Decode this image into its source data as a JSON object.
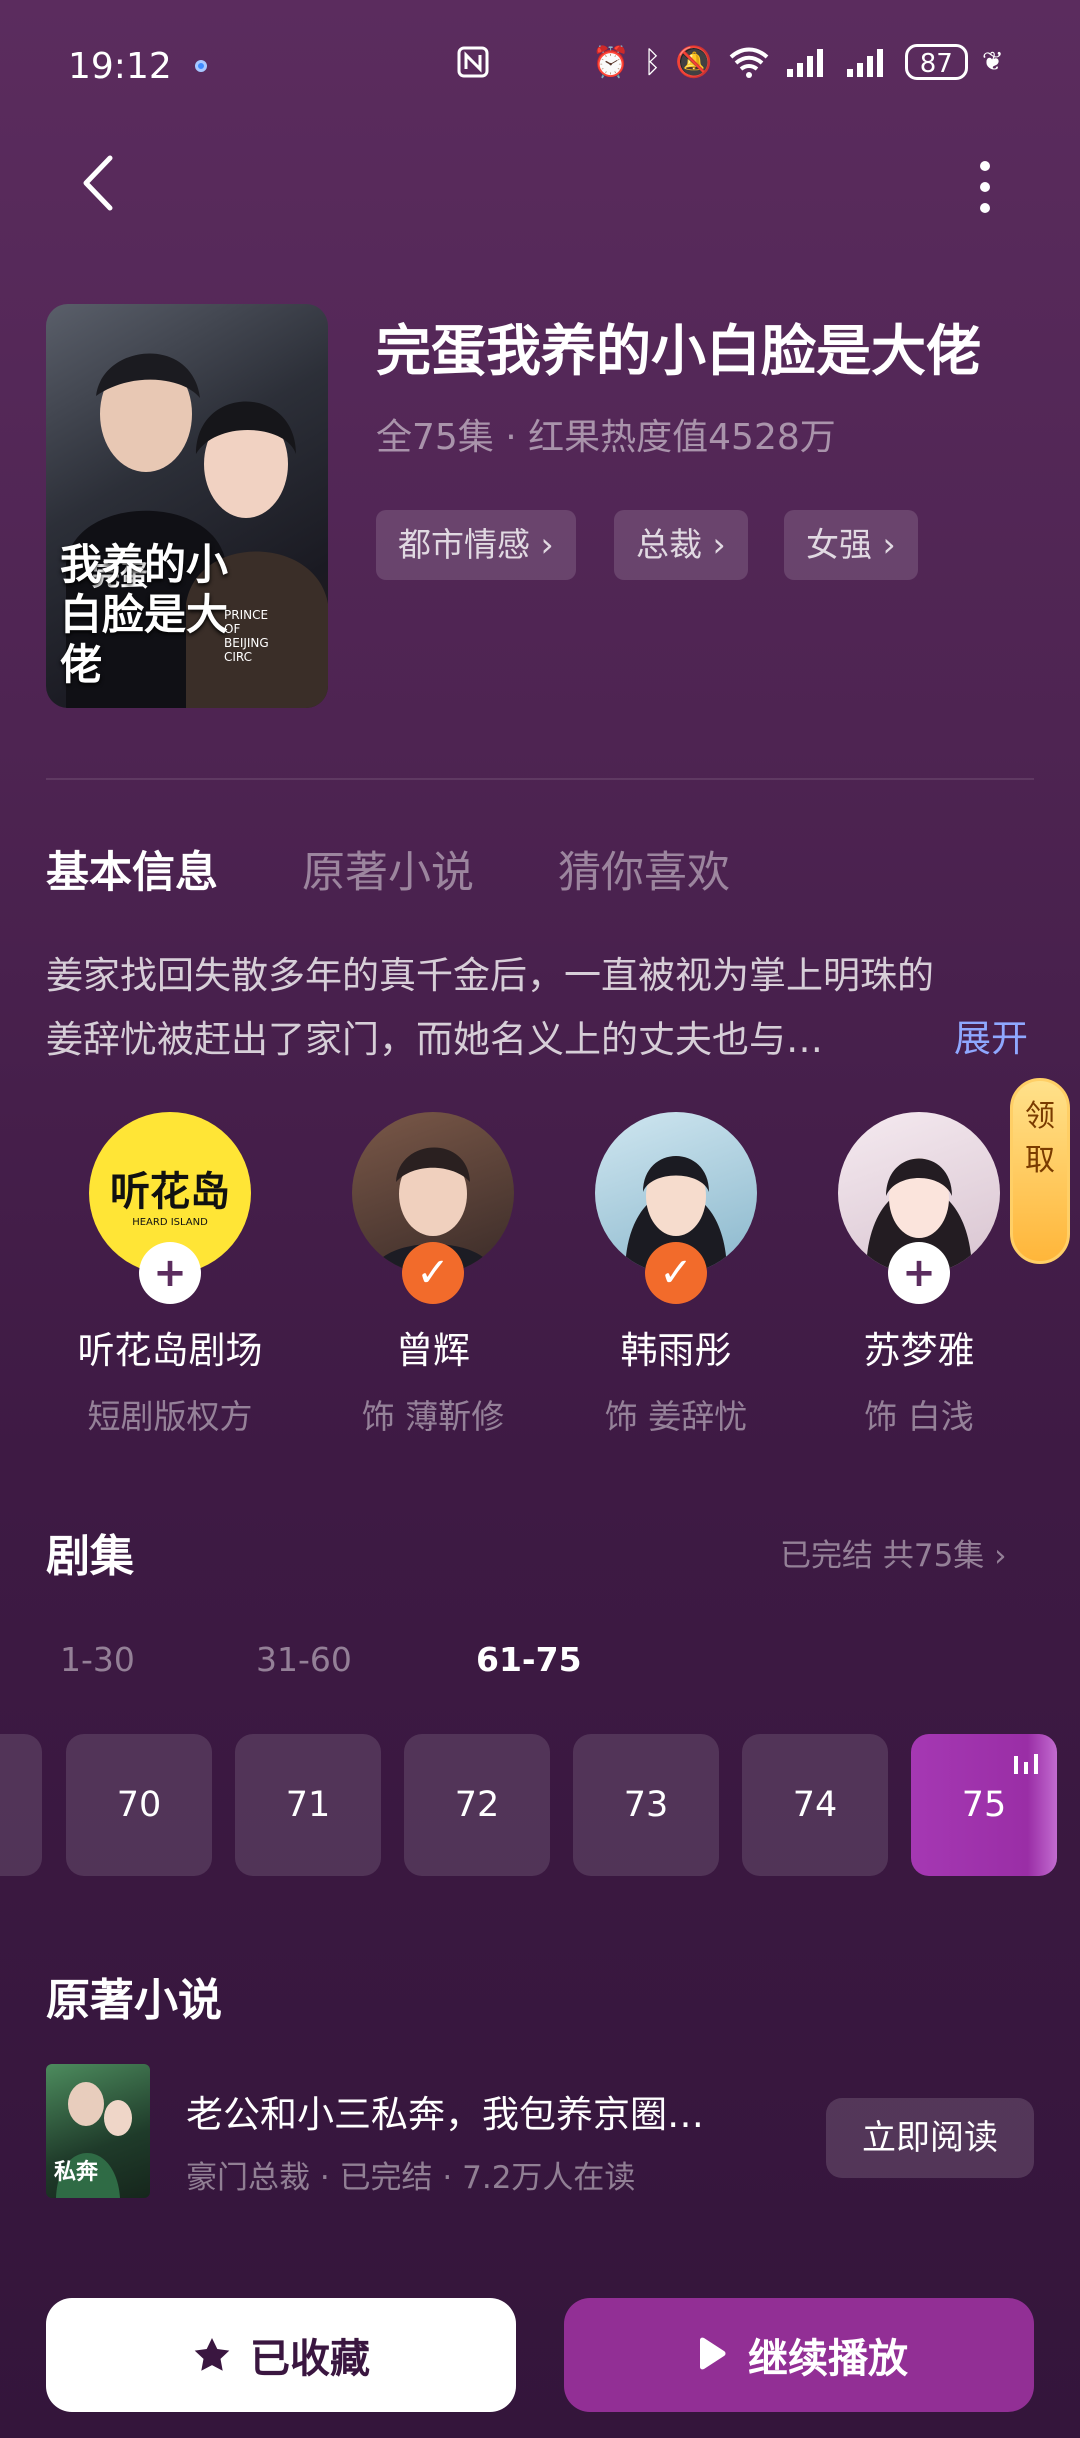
{
  "status_bar": {
    "time": "19:12",
    "battery": "87",
    "network_label": "6"
  },
  "header": {
    "back_icon": "chevron-left-icon",
    "more_icon": "more-vertical-icon"
  },
  "drama": {
    "poster_title_small": "完蛋",
    "poster_title": "我养的小白脸是大佬",
    "poster_en": "PRINCE OF BEIJING CIRC",
    "title": "完蛋我养的小白脸是大佬",
    "meta": "全75集 · 红果热度值4528万",
    "tags": [
      "都市情感 ›",
      "总裁 ›",
      "女强 ›"
    ]
  },
  "tabs": [
    "基本信息",
    "原著小说",
    "猜你喜欢"
  ],
  "description": "姜家找回失散多年的真千金后，一直被视为掌上明珠的姜辞忧被赶出了家门，而她名义上的丈夫也与…",
  "expand_label": "展开",
  "reward_label": "领取",
  "cast": [
    {
      "name": "听花岛剧场",
      "role": "短剧版权方",
      "badge": "+",
      "logo_text": "听花岛",
      "logo_sub": "HEARD ISLAND"
    },
    {
      "name": "曾辉",
      "role": "饰 薄靳修",
      "badge": "✓"
    },
    {
      "name": "韩雨彤",
      "role": "饰 姜辞忧",
      "badge": "✓"
    },
    {
      "name": "苏梦雅",
      "role": "饰 白浅",
      "badge": "+"
    }
  ],
  "episodes": {
    "title": "剧集",
    "status": "已完结 共75集 ›",
    "ranges": [
      "1-30",
      "31-60",
      "61-75"
    ],
    "active_range": "61-75",
    "items": [
      "70",
      "71",
      "72",
      "73",
      "74",
      "75"
    ],
    "active_episode": "75"
  },
  "novel": {
    "section_title": "原著小说",
    "title": "老公和小三私奔，我包养京圈…",
    "meta": "豪门总裁 · 已完结 · 7.2万人在读",
    "read_label": "立即阅读",
    "cover_text": "私奔"
  },
  "bottom": {
    "favorite_label": "已收藏",
    "play_label": "继续播放"
  },
  "colors": {
    "accent": "#922f95",
    "badge_orange": "#f26b2b",
    "link": "#8fa8ff"
  }
}
